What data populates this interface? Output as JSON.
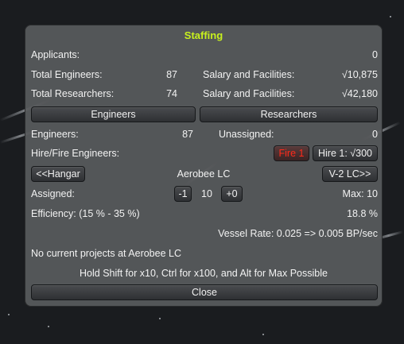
{
  "window": {
    "title": "Staffing"
  },
  "applicants": {
    "label": "Applicants:",
    "value": "0"
  },
  "engineers_row": {
    "label": "Total Engineers:",
    "count": "87",
    "salary_label": "Salary and Facilities:",
    "salary": "√10,875"
  },
  "researchers_row": {
    "label": "Total Researchers:",
    "count": "74",
    "salary_label": "Salary and Facilities:",
    "salary": "√42,180"
  },
  "tabs": {
    "engineers": "Engineers",
    "researchers": "Researchers"
  },
  "engineers_detail": {
    "label": "Engineers:",
    "count": "87",
    "unassigned_label": "Unassigned:",
    "unassigned": "0"
  },
  "hire_fire": {
    "label": "Hire/Fire Engineers:",
    "fire_button": "Fire 1",
    "hire_button": "Hire 1: √300"
  },
  "launch_complex": {
    "prev_button": "<<Hangar",
    "current": "Aerobee LC",
    "next_button": "V-2 LC>>"
  },
  "assigned": {
    "label": "Assigned:",
    "minus_button": "-1",
    "value": "10",
    "plus_button": "+0",
    "max_label": "Max: 10"
  },
  "efficiency": {
    "label": "Efficiency: (15 % - 35 %)",
    "value": "18.8 %"
  },
  "vessel_rate": {
    "text": "Vessel Rate: 0.025 => 0.005 BP/sec"
  },
  "projects": {
    "text": "No current projects at Aerobee LC"
  },
  "hint": {
    "text": "Hold Shift for x10, Ctrl for x100, and Alt for Max Possible"
  },
  "close_button": "Close",
  "colors": {
    "title": "#c8f01e",
    "fire_text": "#ff2a1a",
    "panel": "#585a5d"
  }
}
